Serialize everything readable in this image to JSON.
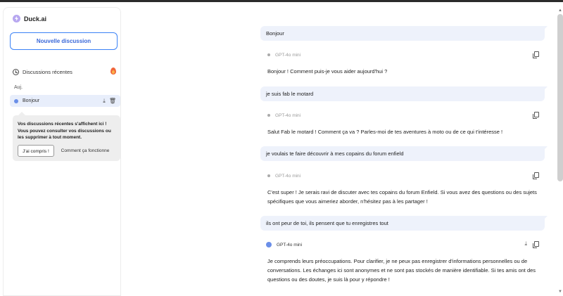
{
  "sidebar": {
    "brand": "Duck.ai",
    "new_chat": "Nouvelle discussion",
    "recent_label": "Discussions récentes",
    "day_label": "Auj.",
    "conversations": [
      {
        "title": "Bonjour"
      }
    ],
    "tooltip": {
      "text": "Vos discussions récentes s'affichent ici ! Vous pouvez consulter vos discussions ou les supprimer à tout moment.",
      "ok_button": "J'ai compris !",
      "how_link": "Comment ça fonctionne"
    }
  },
  "chat": {
    "model": "GPT-4o mini",
    "messages": [
      {
        "role": "user",
        "text": "Bonjour"
      },
      {
        "role": "assistant",
        "text": "Bonjour ! Comment puis-je vous aider aujourd'hui ?"
      },
      {
        "role": "user",
        "text": "je suis fab le motard"
      },
      {
        "role": "assistant",
        "text": "Salut Fab le motard ! Comment ça va ? Parles-moi de tes aventures à moto ou de ce qui t'intéresse !"
      },
      {
        "role": "user",
        "text": "je voulais te faire découvrir à mes copains du forum enfield"
      },
      {
        "role": "assistant",
        "text": "C'est super ! Je serais ravi de discuter avec tes copains du forum Enfield. Si vous avez des questions ou des sujets spécifiques que vous aimeriez aborder, n'hésitez pas à les partager !"
      },
      {
        "role": "user",
        "text": "ils ont peur de toi, ils pensent que tu enregistres tout"
      },
      {
        "role": "assistant",
        "text": "Je comprends leurs préoccupations. Pour clarifier, je ne peux pas enregistrer d'informations personnelles ou de conversations. Les échanges ici sont anonymes et ne sont pas stockés de manière identifiable. Si tes amis ont des questions ou des doutes, je suis là pour y répondre !"
      }
    ]
  }
}
